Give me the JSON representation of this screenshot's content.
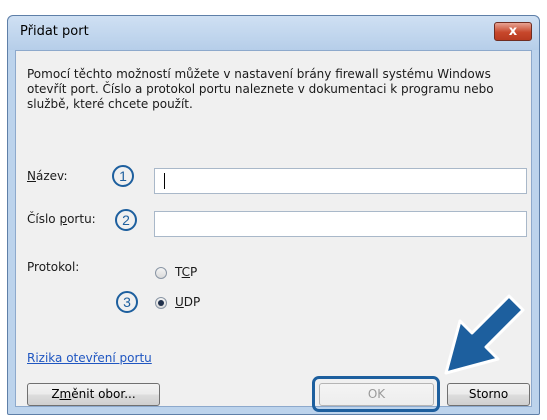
{
  "dialog": {
    "title": "Přidat port",
    "close_symbol": "x",
    "description": "Pomocí těchto možností můžete v nastavení brány firewall systému Windows otevřít port. Číslo a protokol portu naleznete v dokumentaci k programu nebo službě, které chcete použít.",
    "name_label_prefix": "",
    "name_label_u": "N",
    "name_label_rest": "ázev:",
    "name_value": "",
    "port_label_prefix": "Číslo ",
    "port_label_u": "p",
    "port_label_rest": "ortu:",
    "port_value": "",
    "protocol_label": "Protokol:",
    "tcp_prefix": "T",
    "tcp_u": "C",
    "tcp_rest": "P",
    "udp_prefix": "",
    "udp_u": "U",
    "udp_rest": "DP",
    "protocol_selected": "UDP",
    "risk_link": "Rizika otevření portu",
    "scope_prefix": "Z",
    "scope_u": "m",
    "scope_rest": "ěnit obor...",
    "ok_label": "OK",
    "cancel_label": "Storno"
  },
  "callouts": [
    "1",
    "2",
    "3"
  ],
  "icons": {
    "close": "close-icon",
    "arrow": "pointer-arrow-icon"
  },
  "colors": {
    "callout": "#1d5f9e",
    "link": "#1f56c1"
  }
}
